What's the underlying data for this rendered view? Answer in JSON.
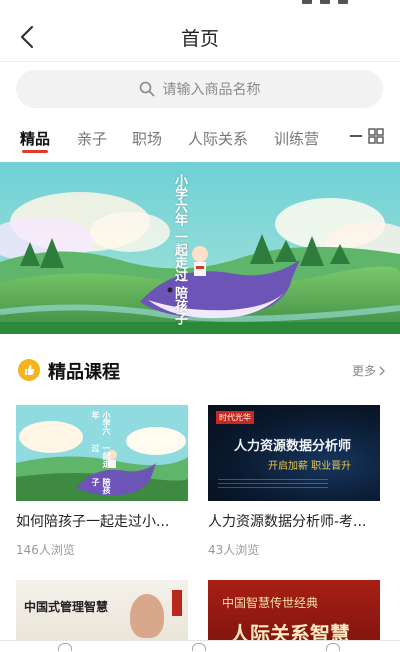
{
  "nav": {
    "title": "首页"
  },
  "search": {
    "placeholder": "请输入商品名称"
  },
  "tabs": [
    {
      "label": "精品",
      "active": true
    },
    {
      "label": "亲子",
      "active": false
    },
    {
      "label": "职场",
      "active": false
    },
    {
      "label": "人际关系",
      "active": false
    },
    {
      "label": "训练营",
      "active": false
    }
  ],
  "banner": {
    "lines": [
      "小学六年",
      "一起走过",
      "陪孩子"
    ]
  },
  "section": {
    "title": "精品课程",
    "more_label": "更多"
  },
  "courses": [
    {
      "title": "如何陪孩子一起走过小...",
      "views": "146人浏览",
      "thumb_lines": [
        "小学六年",
        "一起走过",
        "陪孩子"
      ]
    },
    {
      "title": "人力资源数据分析师-考...",
      "views": "43人浏览",
      "thumb_brand": "时代光华",
      "thumb_main": "人力资源数据分析师",
      "thumb_sub": "开启加薪 职业晋升"
    },
    {
      "thumb_title": "中国式管理智慧"
    },
    {
      "thumb_line1": "中国智慧传世经典",
      "thumb_line2": "人际关系智慧"
    }
  ],
  "colors": {
    "accent": "#e23b2e",
    "section_icon": "#f6b31c"
  }
}
